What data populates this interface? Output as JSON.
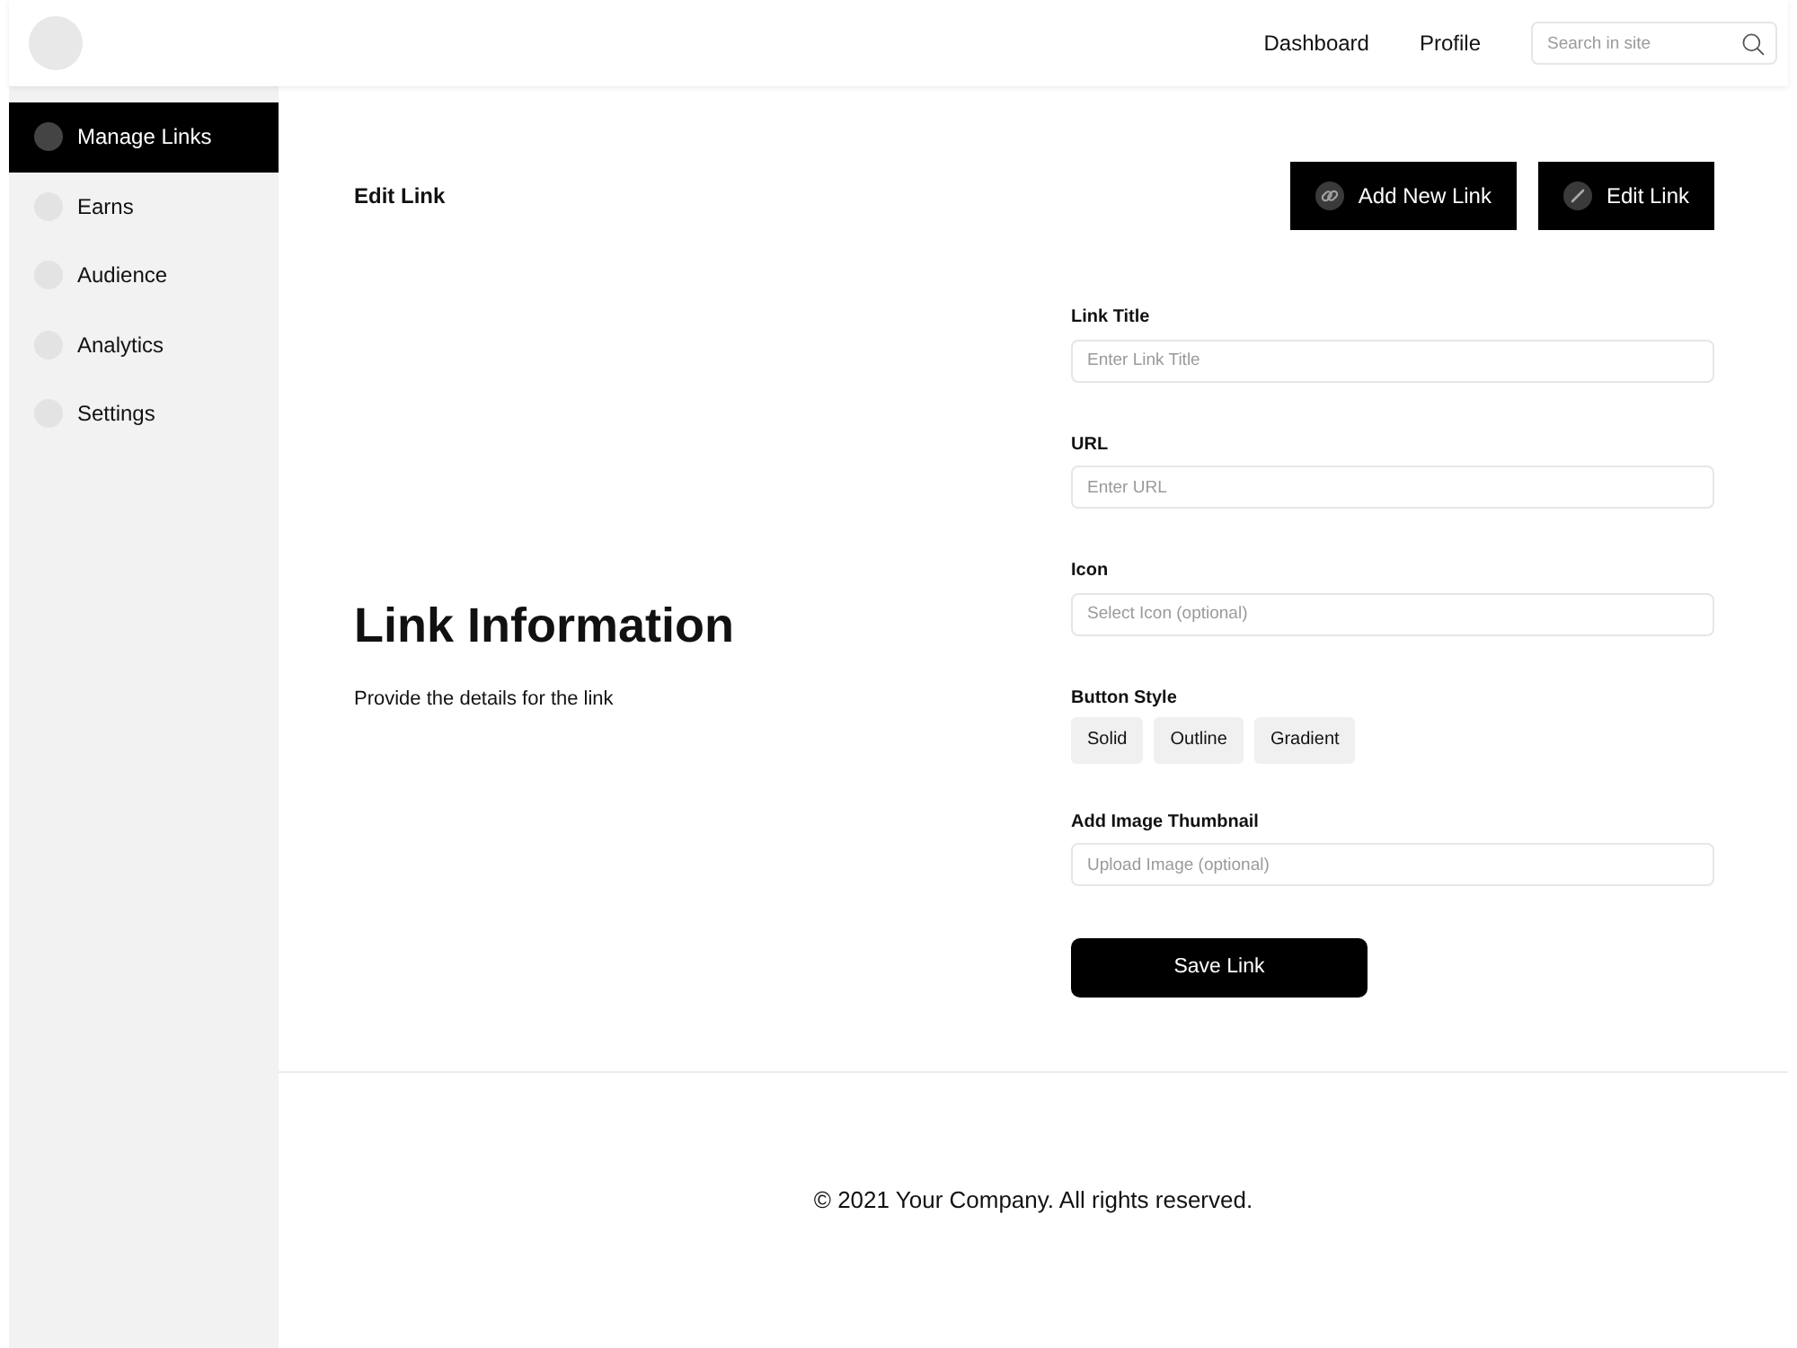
{
  "header": {
    "nav_links": [
      {
        "label": "Dashboard"
      },
      {
        "label": "Profile"
      }
    ],
    "search": {
      "placeholder": "Search in site"
    }
  },
  "sidebar": {
    "items": [
      {
        "label": "Manage Links",
        "selected": true
      },
      {
        "label": "Earns",
        "selected": false
      },
      {
        "label": "Audience",
        "selected": false
      },
      {
        "label": "Analytics",
        "selected": false
      },
      {
        "label": "Settings",
        "selected": false
      }
    ]
  },
  "page_header": {
    "title": "Edit Link",
    "actions": [
      {
        "label": "Add New Link"
      },
      {
        "label": "Edit Link"
      }
    ]
  },
  "section": {
    "title": "Link Information",
    "description": "Provide the details for the link"
  },
  "form": {
    "fields": [
      {
        "kind": "text",
        "label": "Link Title",
        "placeholder": "Enter Link Title"
      },
      {
        "kind": "text",
        "label": "URL",
        "placeholder": "Enter URL"
      },
      {
        "kind": "text",
        "label": "Icon",
        "placeholder": "Select Icon (optional)"
      },
      {
        "kind": "choices",
        "label": "Button Style",
        "options": [
          {
            "label": "Solid",
            "selected": false
          },
          {
            "label": "Outline",
            "selected": false
          },
          {
            "label": "Gradient",
            "selected": false
          }
        ]
      },
      {
        "kind": "text",
        "label": "Add Image Thumbnail",
        "placeholder": "Upload Image (optional)"
      }
    ],
    "submit": "Save Link"
  },
  "footer": {
    "text": "© 2021 Your Company. All rights reserved."
  }
}
